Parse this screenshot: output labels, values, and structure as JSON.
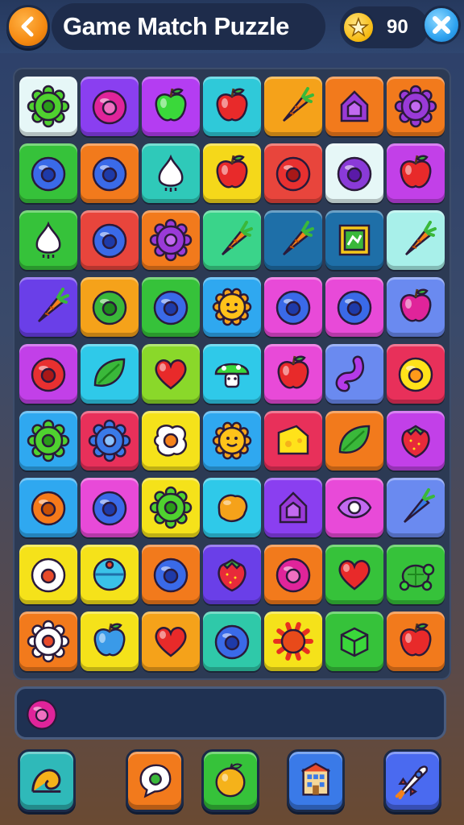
{
  "header": {
    "title": "Game Match Puzzle",
    "score": "90",
    "back_icon": "chevron-left-icon",
    "close_icon": "close-icon",
    "score_icon": "star-coin-icon"
  },
  "board": {
    "rows": 9,
    "cols": 7,
    "tiles": [
      [
        {
          "bg": "#e6f7f7",
          "icon": "green-gear"
        },
        {
          "bg": "#8a3ff0",
          "icon": "pink-ring"
        },
        {
          "bg": "#b43df2",
          "icon": "green-apple"
        },
        {
          "bg": "#2fc9d9",
          "icon": "red-apple"
        },
        {
          "bg": "#f5a21a",
          "icon": "carrot"
        },
        {
          "bg": "#f27a1c",
          "icon": "purple-house"
        },
        {
          "bg": "#f27a1c",
          "icon": "purple-gear"
        }
      ],
      [
        {
          "bg": "#36c23a",
          "icon": "blue-ring"
        },
        {
          "bg": "#f27a1c",
          "icon": "blue-ring"
        },
        {
          "bg": "#2fc9b9",
          "icon": "white-onion"
        },
        {
          "bg": "#f5d81a",
          "icon": "red-apple"
        },
        {
          "bg": "#e8453c",
          "icon": "red-ring"
        },
        {
          "bg": "#e6f7f7",
          "icon": "purple-ring"
        },
        {
          "bg": "#c240e8",
          "icon": "red-apple"
        }
      ],
      [
        {
          "bg": "#36c23a",
          "icon": "white-onion"
        },
        {
          "bg": "#e8453c",
          "icon": "blue-ring"
        },
        {
          "bg": "#f27a1c",
          "icon": "purple-gear"
        },
        {
          "bg": "#3ad48a",
          "icon": "carrot"
        },
        {
          "bg": "#1e6fa8",
          "icon": "carrot"
        },
        {
          "bg": "#1e6fa8",
          "icon": "framed-picture"
        },
        {
          "bg": "#a8f0ea",
          "icon": "carrot"
        }
      ],
      [
        {
          "bg": "#6a3fe8",
          "icon": "carrot"
        },
        {
          "bg": "#f5a21a",
          "icon": "green-ring"
        },
        {
          "bg": "#36c23a",
          "icon": "blue-ring"
        },
        {
          "bg": "#2fa8f0",
          "icon": "sun-face"
        },
        {
          "bg": "#e84ad8",
          "icon": "blue-ring"
        },
        {
          "bg": "#e84ad8",
          "icon": "blue-ring"
        },
        {
          "bg": "#6a8af0",
          "icon": "pink-apple"
        }
      ],
      [
        {
          "bg": "#c240e8",
          "icon": "red-ring"
        },
        {
          "bg": "#2fc9e9",
          "icon": "green-leaf"
        },
        {
          "bg": "#8ad82a",
          "icon": "red-heart"
        },
        {
          "bg": "#2fc9e9",
          "icon": "mushroom"
        },
        {
          "bg": "#e84ad8",
          "icon": "red-apple"
        },
        {
          "bg": "#6a8af0",
          "icon": "purple-worm"
        },
        {
          "bg": "#e8305a",
          "icon": "yellow-ring"
        }
      ],
      [
        {
          "bg": "#2fa8f0",
          "icon": "green-gear"
        },
        {
          "bg": "#e8305a",
          "icon": "blue-gear"
        },
        {
          "bg": "#f5e21a",
          "icon": "fried-egg"
        },
        {
          "bg": "#2fa8f0",
          "icon": "sun-face"
        },
        {
          "bg": "#e8305a",
          "icon": "cheese"
        },
        {
          "bg": "#f27a1c",
          "icon": "green-leaf"
        },
        {
          "bg": "#c240e8",
          "icon": "strawberry"
        }
      ],
      [
        {
          "bg": "#2fa8f0",
          "icon": "orange-ring"
        },
        {
          "bg": "#e84ad8",
          "icon": "blue-ring"
        },
        {
          "bg": "#f5e21a",
          "icon": "green-gear"
        },
        {
          "bg": "#2fc9e9",
          "icon": "orange-blob"
        },
        {
          "bg": "#8a3ff0",
          "icon": "purple-house"
        },
        {
          "bg": "#e84ad8",
          "icon": "eye-blob"
        },
        {
          "bg": "#6a8af0",
          "icon": "blue-carrot"
        }
      ],
      [
        {
          "bg": "#f5e21a",
          "icon": "white-ring"
        },
        {
          "bg": "#f5e21a",
          "icon": "blue-ball"
        },
        {
          "bg": "#f27a1c",
          "icon": "blue-ring"
        },
        {
          "bg": "#6a3fe8",
          "icon": "strawberry"
        },
        {
          "bg": "#f27a1c",
          "icon": "pink-ring"
        },
        {
          "bg": "#36c23a",
          "icon": "red-heart"
        },
        {
          "bg": "#36c23a",
          "icon": "turtle"
        }
      ],
      [
        {
          "bg": "#f27a1c",
          "icon": "white-gear"
        },
        {
          "bg": "#f5e21a",
          "icon": "blue-apple"
        },
        {
          "bg": "#f5a21a",
          "icon": "red-heart"
        },
        {
          "bg": "#2fc9a9",
          "icon": "blue-ring"
        },
        {
          "bg": "#f5e21a",
          "icon": "red-sun"
        },
        {
          "bg": "#36c23a",
          "icon": "green-cube"
        },
        {
          "bg": "#f27a1c",
          "icon": "red-apple"
        }
      ]
    ]
  },
  "tray": {
    "items": [
      "pink-ring"
    ]
  },
  "powerups": [
    {
      "name": "shell-powerup",
      "icon": "snail-shell",
      "bg": "#2fb9b9"
    },
    {
      "name": "speech-powerup",
      "icon": "speech-bubble",
      "bg": "#f27a1c"
    },
    {
      "name": "fruit-powerup",
      "icon": "orange-fruit",
      "bg": "#36c23a"
    },
    {
      "name": "building-powerup",
      "icon": "building",
      "bg": "#3a7ae8"
    },
    {
      "name": "rocket-powerup",
      "icon": "rocket",
      "bg": "#4a6af0"
    }
  ]
}
